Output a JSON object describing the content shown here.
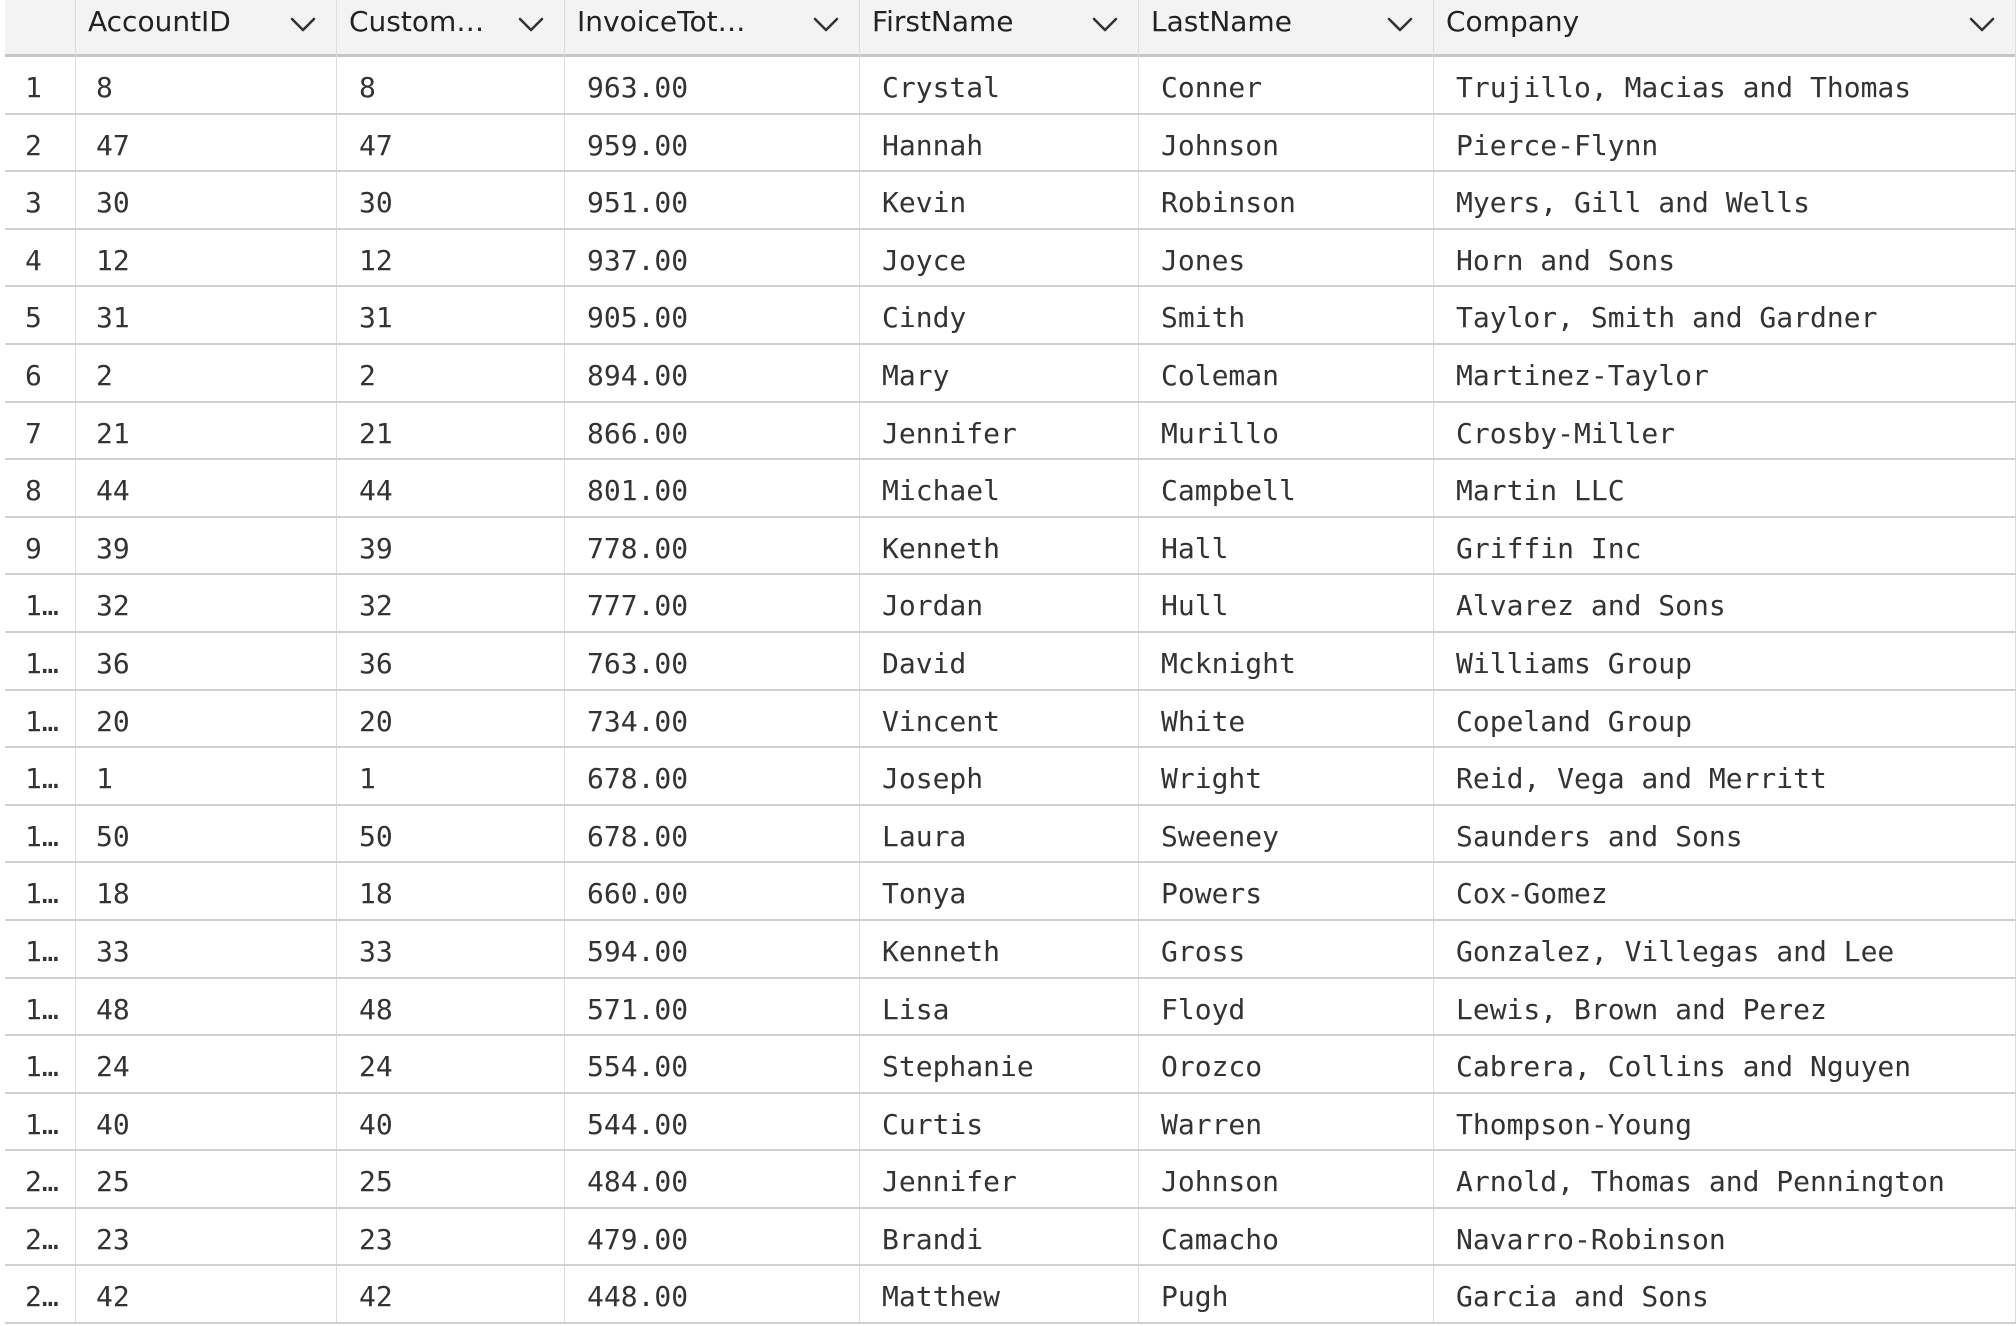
{
  "grid": {
    "columns": [
      {
        "label": ""
      },
      {
        "label": "AccountID"
      },
      {
        "label": "Custom…"
      },
      {
        "label": "InvoiceTot…"
      },
      {
        "label": "FirstName"
      },
      {
        "label": "LastName"
      },
      {
        "label": "Company"
      }
    ],
    "rows": [
      [
        "1",
        "8",
        "8",
        "963.00",
        "Crystal",
        "Conner",
        "Trujillo, Macias and Thomas"
      ],
      [
        "2",
        "47",
        "47",
        "959.00",
        "Hannah",
        "Johnson",
        "Pierce-Flynn"
      ],
      [
        "3",
        "30",
        "30",
        "951.00",
        "Kevin",
        "Robinson",
        "Myers, Gill and Wells"
      ],
      [
        "4",
        "12",
        "12",
        "937.00",
        "Joyce",
        "Jones",
        "Horn and Sons"
      ],
      [
        "5",
        "31",
        "31",
        "905.00",
        "Cindy",
        "Smith",
        "Taylor, Smith and Gardner"
      ],
      [
        "6",
        "2",
        "2",
        "894.00",
        "Mary",
        "Coleman",
        "Martinez-Taylor"
      ],
      [
        "7",
        "21",
        "21",
        "866.00",
        "Jennifer",
        "Murillo",
        "Crosby-Miller"
      ],
      [
        "8",
        "44",
        "44",
        "801.00",
        "Michael",
        "Campbell",
        "Martin LLC"
      ],
      [
        "9",
        "39",
        "39",
        "778.00",
        "Kenneth",
        "Hall",
        "Griffin Inc"
      ],
      [
        "1…",
        "32",
        "32",
        "777.00",
        "Jordan",
        "Hull",
        "Alvarez and Sons"
      ],
      [
        "1…",
        "36",
        "36",
        "763.00",
        "David",
        "Mcknight",
        "Williams Group"
      ],
      [
        "1…",
        "20",
        "20",
        "734.00",
        "Vincent",
        "White",
        "Copeland Group"
      ],
      [
        "1…",
        "1",
        "1",
        "678.00",
        "Joseph",
        "Wright",
        "Reid, Vega and Merritt"
      ],
      [
        "1…",
        "50",
        "50",
        "678.00",
        "Laura",
        "Sweeney",
        "Saunders and Sons"
      ],
      [
        "1…",
        "18",
        "18",
        "660.00",
        "Tonya",
        "Powers",
        "Cox-Gomez"
      ],
      [
        "1…",
        "33",
        "33",
        "594.00",
        "Kenneth",
        "Gross",
        "Gonzalez, Villegas and Lee"
      ],
      [
        "1…",
        "48",
        "48",
        "571.00",
        "Lisa",
        "Floyd",
        "Lewis, Brown and Perez"
      ],
      [
        "1…",
        "24",
        "24",
        "554.00",
        "Stephanie",
        "Orozco",
        "Cabrera, Collins and Nguyen"
      ],
      [
        "1…",
        "40",
        "40",
        "544.00",
        "Curtis",
        "Warren",
        "Thompson-Young"
      ],
      [
        "2…",
        "25",
        "25",
        "484.00",
        "Jennifer",
        "Johnson",
        "Arnold, Thomas and Pennington"
      ],
      [
        "2…",
        "23",
        "23",
        "479.00",
        "Brandi",
        "Camacho",
        "Navarro-Robinson"
      ],
      [
        "2…",
        "42",
        "42",
        "448.00",
        "Matthew",
        "Pugh",
        "Garcia and Sons"
      ]
    ]
  },
  "icons": {
    "column_menu": "chevron-down-icon"
  }
}
